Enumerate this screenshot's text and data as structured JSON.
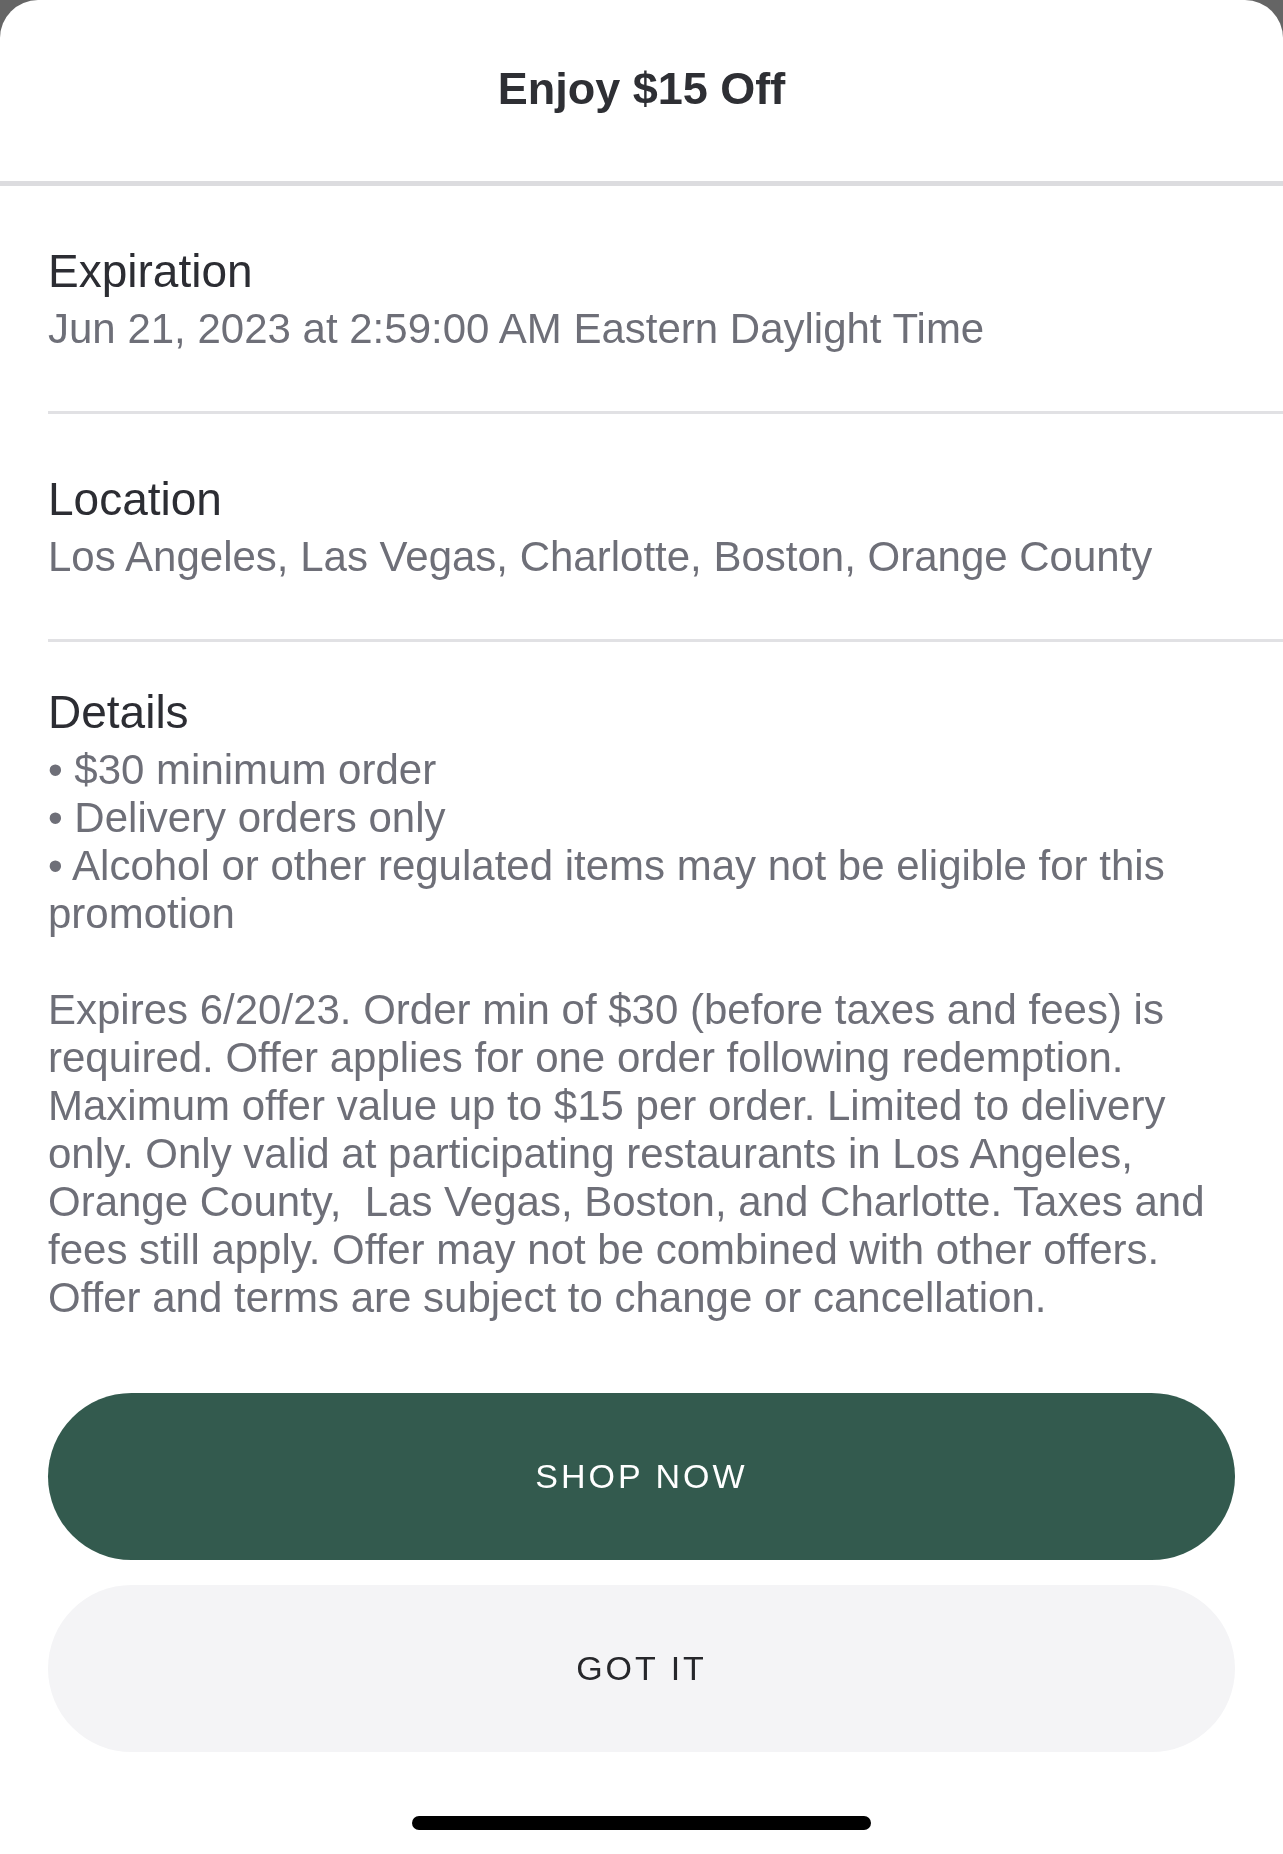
{
  "title": "Enjoy $15 Off",
  "sections": [
    {
      "label": "Expiration",
      "value": "Jun 21, 2023 at 2:59:00 AM Eastern Daylight Time"
    },
    {
      "label": "Location",
      "value": "Los Angeles, Las Vegas, Charlotte, Boston, Orange County"
    }
  ],
  "details": {
    "label": "Details",
    "items": [
      "• $30 minimum order",
      "• Delivery orders only",
      "• Alcohol or other regulated items may not be eligible for this promotion"
    ],
    "terms": "Expires 6/20/23. Order min of $30 (before taxes and fees) is required. Offer applies for one order following redemption. Maximum offer value up to $15 per order. Limited to delivery only. Only valid at participating restaurants in Los Angeles, Orange County,  Las Vegas, Boston, and Charlotte. Taxes and fees still apply. Offer may not be combined with other offers. Offer and terms are subject to change or cancellation."
  },
  "buttons": [
    {
      "label": "SHOP NOW",
      "kind": "primary"
    },
    {
      "label": "GOT IT",
      "kind": "secondary"
    }
  ]
}
